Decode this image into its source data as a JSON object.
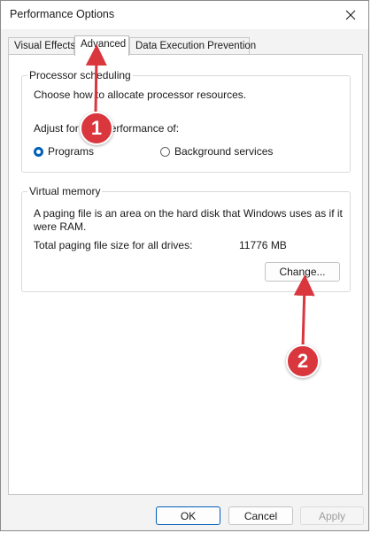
{
  "window": {
    "title": "Performance Options",
    "close_icon": "close-icon"
  },
  "tabs": [
    {
      "label": "Visual Effects",
      "active": false
    },
    {
      "label": "Advanced",
      "active": true
    },
    {
      "label": "Data Execution Prevention",
      "active": false
    }
  ],
  "processor_scheduling": {
    "legend": "Processor scheduling",
    "description": "Choose how to allocate processor resources.",
    "adjust_label": "Adjust for best performance of:",
    "options": [
      {
        "label": "Programs",
        "selected": true
      },
      {
        "label": "Background services",
        "selected": false
      }
    ]
  },
  "virtual_memory": {
    "legend": "Virtual memory",
    "description": "A paging file is an area on the hard disk that Windows uses as if it were RAM.",
    "total_label": "Total paging file size for all drives:",
    "total_value": "11776 MB",
    "change_button": "Change..."
  },
  "footer": {
    "ok": "OK",
    "cancel": "Cancel",
    "apply": "Apply"
  },
  "annotations": {
    "callout_1": "1",
    "callout_2": "2",
    "color": "#d9363e"
  }
}
